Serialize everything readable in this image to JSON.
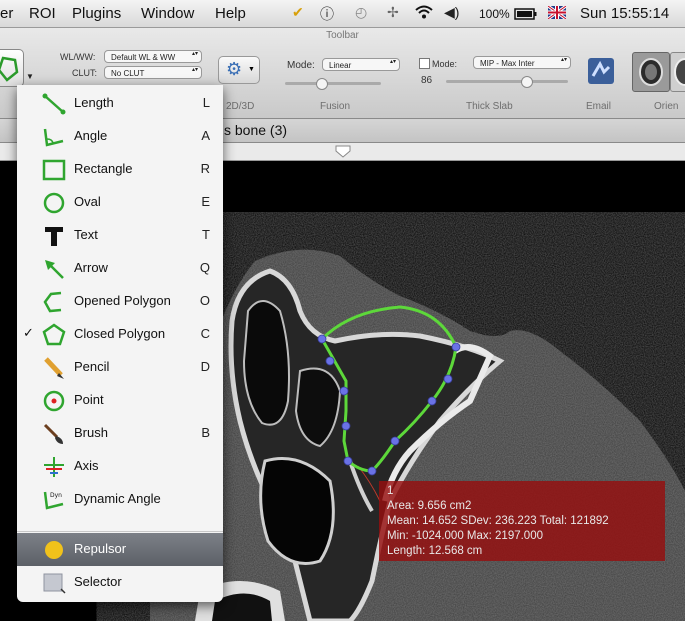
{
  "menubar": {
    "items": [
      "er",
      "ROI",
      "Plugins",
      "Window",
      "Help"
    ],
    "battery": "100%",
    "clock": "Sun 15:55:14"
  },
  "toolbar": {
    "title": "Toolbar",
    "wlww_label": "WL/WW:",
    "wlww_value": "Default WL & WW",
    "clut_label": "CLUT:",
    "clut_value": "No CLUT",
    "mode_label": "Mode:",
    "fusion_mode": "Linear",
    "thick_mode_label": "Mode:",
    "thick_mode": "MIP - Max Inter",
    "thick_value": "86",
    "sections": {
      "d2d3d": "2D/3D",
      "fusion": "Fusion",
      "thick_slab": "Thick Slab",
      "email": "Email",
      "orientation": "Orien"
    }
  },
  "series": {
    "title": "s bone (3)"
  },
  "roi_menu": {
    "items": [
      {
        "label": "Length",
        "key": "L",
        "checked": false,
        "icon": "length-icon"
      },
      {
        "label": "Angle",
        "key": "A",
        "checked": false,
        "icon": "angle-icon"
      },
      {
        "label": "Rectangle",
        "key": "R",
        "checked": false,
        "icon": "rectangle-icon"
      },
      {
        "label": "Oval",
        "key": "E",
        "checked": false,
        "icon": "oval-icon"
      },
      {
        "label": "Text",
        "key": "T",
        "checked": false,
        "icon": "text-icon"
      },
      {
        "label": "Arrow",
        "key": "Q",
        "checked": false,
        "icon": "arrow-icon"
      },
      {
        "label": "Opened Polygon",
        "key": "O",
        "checked": false,
        "icon": "opened-polygon-icon"
      },
      {
        "label": "Closed Polygon",
        "key": "C",
        "checked": true,
        "icon": "closed-polygon-icon"
      },
      {
        "label": "Pencil",
        "key": "D",
        "checked": false,
        "icon": "pencil-icon"
      },
      {
        "label": "Point",
        "key": "",
        "checked": false,
        "icon": "point-icon"
      },
      {
        "label": "Brush",
        "key": "B",
        "checked": false,
        "icon": "brush-icon"
      },
      {
        "label": "Axis",
        "key": "",
        "checked": false,
        "icon": "axis-icon"
      },
      {
        "label": "Dynamic Angle",
        "key": "",
        "checked": false,
        "icon": "dynamic-angle-icon"
      }
    ],
    "bottom_items": [
      {
        "label": "Repulsor",
        "selected": true,
        "icon": "repulsor-icon"
      },
      {
        "label": "Selector",
        "selected": false,
        "icon": "selector-icon"
      }
    ],
    "check_glyph": "✓",
    "dyn_text": "Dyn"
  },
  "roi_info": {
    "name": "1",
    "area": "Area: 9.656 cm2",
    "stats1": "Mean: 14.652 SDev: 236.223 Total: 121892",
    "stats2": "Min: -1024.000 Max: 2197.000",
    "length": "Length: 12.568 cm"
  },
  "colors": {
    "roi_outline": "#5dd83a",
    "roi_handle": "#6a72e6",
    "info_box": "#960f0f",
    "menu_selection": "#6b6f76"
  }
}
